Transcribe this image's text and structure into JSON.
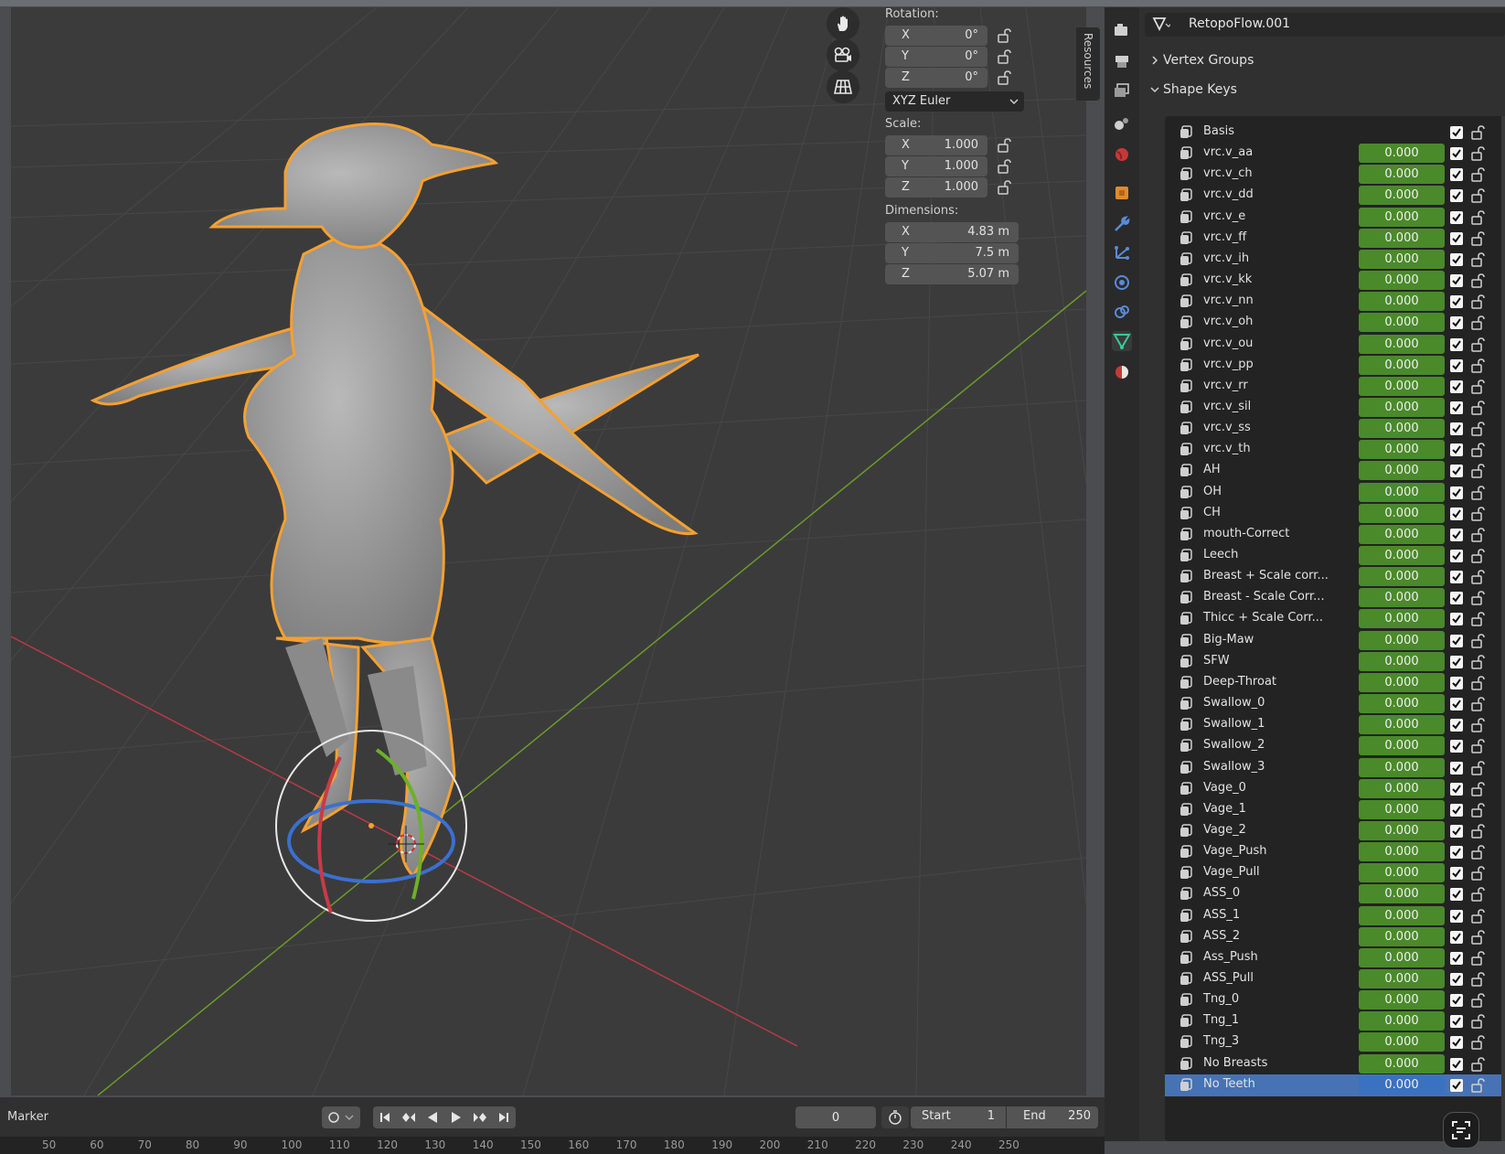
{
  "npanel": {
    "rotation_label": "Rotation:",
    "rotation": [
      {
        "axis": "X",
        "value": "0°"
      },
      {
        "axis": "Y",
        "value": "0°"
      },
      {
        "axis": "Z",
        "value": "0°"
      }
    ],
    "rotation_mode": "XYZ Euler",
    "scale_label": "Scale:",
    "scale": [
      {
        "axis": "X",
        "value": "1.000"
      },
      {
        "axis": "Y",
        "value": "1.000"
      },
      {
        "axis": "Z",
        "value": "1.000"
      }
    ],
    "dimensions_label": "Dimensions:",
    "dimensions": [
      {
        "axis": "X",
        "value": "4.83 m"
      },
      {
        "axis": "Y",
        "value": "7.5 m"
      },
      {
        "axis": "Z",
        "value": "5.07 m"
      }
    ],
    "resources_tab": "Resources"
  },
  "timeline": {
    "marker_label": "Marker",
    "current_frame": "0",
    "start_label": "Start",
    "start_value": "1",
    "end_label": "End",
    "end_value": "250",
    "ruler": [
      "50",
      "60",
      "70",
      "80",
      "90",
      "100",
      "110",
      "120",
      "130",
      "140",
      "150",
      "160",
      "170",
      "180",
      "190",
      "200",
      "210",
      "220",
      "230",
      "240",
      "250"
    ]
  },
  "properties": {
    "mesh_name": "RetopoFlow.001",
    "vertex_groups": "Vertex Groups",
    "shape_keys": "Shape Keys",
    "keys": [
      {
        "name": "Basis",
        "value": ""
      },
      {
        "name": "vrc.v_aa",
        "value": "0.000"
      },
      {
        "name": "vrc.v_ch",
        "value": "0.000"
      },
      {
        "name": "vrc.v_dd",
        "value": "0.000"
      },
      {
        "name": "vrc.v_e",
        "value": "0.000"
      },
      {
        "name": "vrc.v_ff",
        "value": "0.000"
      },
      {
        "name": "vrc.v_ih",
        "value": "0.000"
      },
      {
        "name": "vrc.v_kk",
        "value": "0.000"
      },
      {
        "name": "vrc.v_nn",
        "value": "0.000"
      },
      {
        "name": "vrc.v_oh",
        "value": "0.000"
      },
      {
        "name": "vrc.v_ou",
        "value": "0.000"
      },
      {
        "name": "vrc.v_pp",
        "value": "0.000"
      },
      {
        "name": "vrc.v_rr",
        "value": "0.000"
      },
      {
        "name": "vrc.v_sil",
        "value": "0.000"
      },
      {
        "name": "vrc.v_ss",
        "value": "0.000"
      },
      {
        "name": "vrc.v_th",
        "value": "0.000"
      },
      {
        "name": "AH",
        "value": "0.000"
      },
      {
        "name": "OH",
        "value": "0.000"
      },
      {
        "name": "CH",
        "value": "0.000"
      },
      {
        "name": "mouth-Correct",
        "value": "0.000"
      },
      {
        "name": "Leech",
        "value": "0.000"
      },
      {
        "name": "Breast + Scale corr...",
        "value": "0.000"
      },
      {
        "name": "Breast - Scale Corr...",
        "value": "0.000"
      },
      {
        "name": "Thicc + Scale Corr...",
        "value": "0.000"
      },
      {
        "name": "Big-Maw",
        "value": "0.000"
      },
      {
        "name": "SFW",
        "value": "0.000"
      },
      {
        "name": "Deep-Throat",
        "value": "0.000"
      },
      {
        "name": "Swallow_0",
        "value": "0.000"
      },
      {
        "name": "Swallow_1",
        "value": "0.000"
      },
      {
        "name": "Swallow_2",
        "value": "0.000"
      },
      {
        "name": "Swallow_3",
        "value": "0.000"
      },
      {
        "name": "Vage_0",
        "value": "0.000"
      },
      {
        "name": "Vage_1",
        "value": "0.000"
      },
      {
        "name": "Vage_2",
        "value": "0.000"
      },
      {
        "name": "Vage_Push",
        "value": "0.000"
      },
      {
        "name": "Vage_Pull",
        "value": "0.000"
      },
      {
        "name": "ASS_0",
        "value": "0.000"
      },
      {
        "name": "ASS_1",
        "value": "0.000"
      },
      {
        "name": "ASS_2",
        "value": "0.000"
      },
      {
        "name": "Ass_Push",
        "value": "0.000"
      },
      {
        "name": "ASS_Pull",
        "value": "0.000"
      },
      {
        "name": "Tng_0",
        "value": "0.000"
      },
      {
        "name": "Tng_1",
        "value": "0.000"
      },
      {
        "name": "Tng_3",
        "value": "0.000"
      },
      {
        "name": "No Breasts",
        "value": "0.000"
      },
      {
        "name": "No Teeth",
        "value": "0.000"
      }
    ],
    "selected_index": 45
  },
  "colors": {
    "selection_outline": "#f5a030",
    "x_axis": "#b83a48",
    "y_axis": "#6c9a2a",
    "z_axis": "#3a70d0",
    "value_field": "#4a8a2a",
    "active_row": "#4772b3"
  },
  "icons": {
    "nav": [
      "hand-pan-icon",
      "camera-icon",
      "grid-view-icon"
    ],
    "tabs": [
      "render-icon",
      "output-icon",
      "view-layer-icon",
      "scene-icon",
      "world-icon",
      "object-icon",
      "modifier-icon",
      "particles-icon",
      "physics-icon",
      "constraints-icon",
      "mesh-data-icon",
      "material-icon"
    ]
  }
}
